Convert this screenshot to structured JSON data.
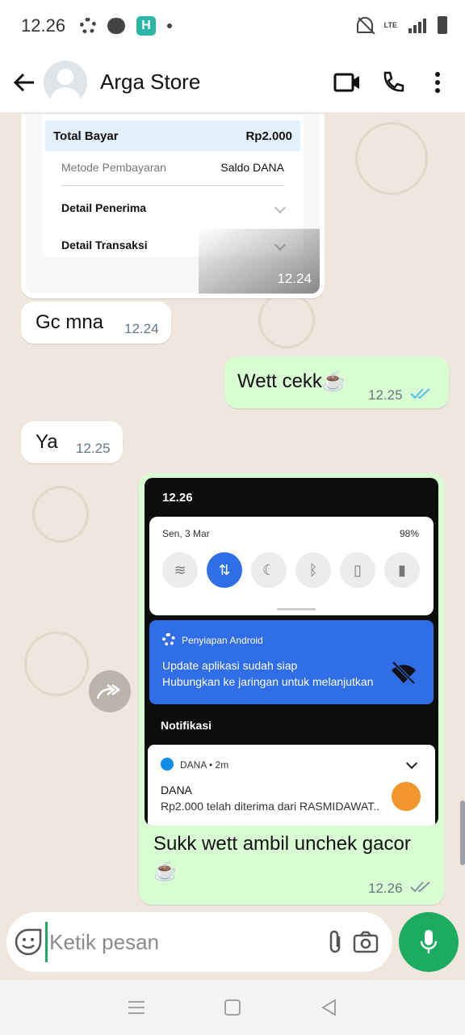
{
  "status_bar": {
    "time": "12.26",
    "network": "LTE"
  },
  "header": {
    "contact_name": "Arga Store"
  },
  "receipt": {
    "total_label": "Total Bayar",
    "total_value": "Rp2.000",
    "method_label": "Metode Pembayaran",
    "method_value": "Saldo DANA",
    "recipient_detail": "Detail Penerima",
    "transaction_detail": "Detail Transaksi",
    "time": "12.24"
  },
  "messages": [
    {
      "direction": "in",
      "text": "Gc mna",
      "time": "12.24"
    },
    {
      "direction": "out",
      "text": "Wett cekk☕",
      "time": "12.25",
      "status": "read"
    },
    {
      "direction": "in",
      "text": "Ya",
      "time": "12.25"
    }
  ],
  "screenshot_message": {
    "phone_time": "12.26",
    "qs_date": "Sen, 3 Mar",
    "qs_battery": "98%",
    "android_source": "Penyiapan Android",
    "android_title": "Update aplikasi sudah siap",
    "android_sub": "Hubungkan ke jaringan untuk melanjutkan",
    "notif_section": "Notifikasi",
    "dana_app": "DANA • 2m",
    "dana_title": "DANA",
    "dana_body": "Rp2.000 telah diterima dari RASMIDAWAT..",
    "caption": "Sukk wett ambil unchek gacor ☕",
    "time": "12.26",
    "status": "delivered"
  },
  "input": {
    "placeholder": "Ketik pesan"
  },
  "colors": {
    "accent": "#1daa61",
    "outgoing": "#d9fdd3",
    "incoming": "#ffffff",
    "read_tick": "#53bdeb",
    "wallpaper": "#efe7de"
  },
  "icons": [
    "back-arrow-icon",
    "video-call-icon",
    "phone-icon",
    "more-vert-icon",
    "sticker-icon",
    "attach-icon",
    "camera-icon",
    "mic-icon",
    "forward-icon"
  ]
}
